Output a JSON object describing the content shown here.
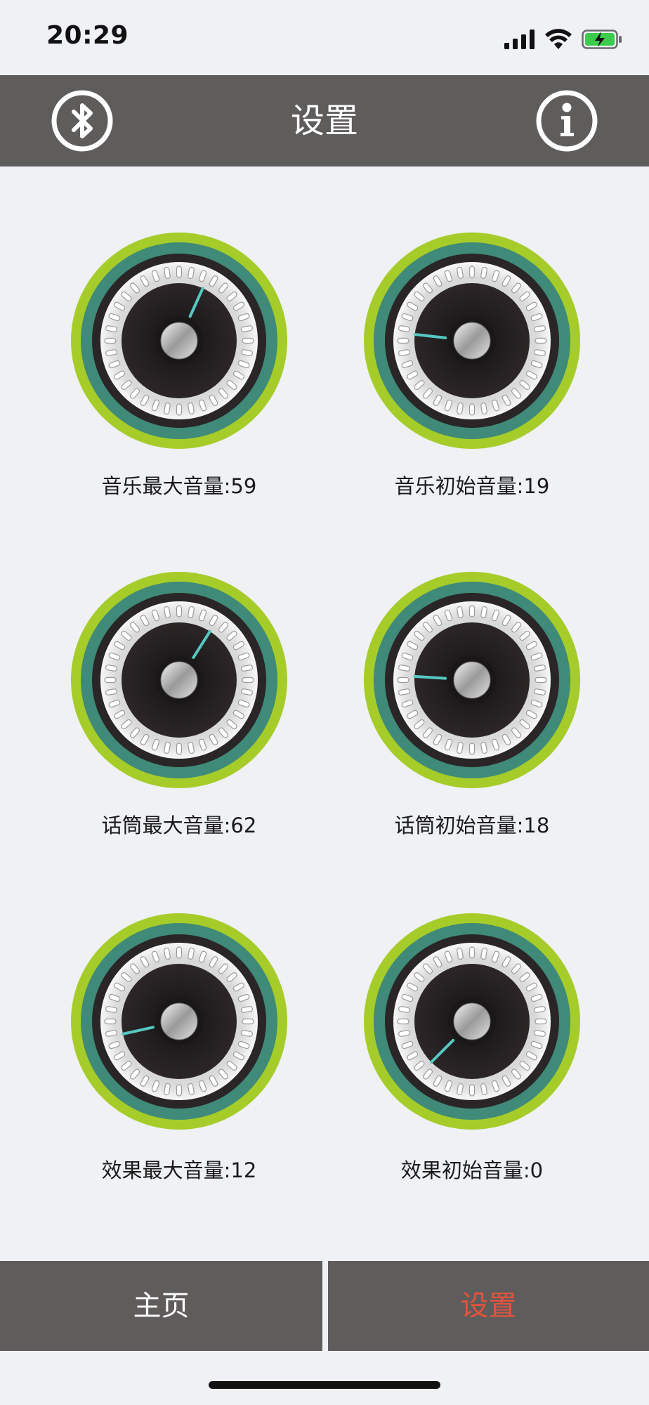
{
  "status_bar": {
    "time": "20:29",
    "icons": [
      "signal-icon",
      "wifi-icon",
      "battery-charging-icon"
    ]
  },
  "nav": {
    "title": "设置",
    "left_icon": "bluetooth-icon",
    "right_icon": "info-icon"
  },
  "colors": {
    "nav_bg": "#5f5c5c",
    "active_tab": "#e3533c",
    "ring_outer": "#a6cc2a",
    "ring_mid": "#3f8a78",
    "indicator": "#56c8c2"
  },
  "knobs": [
    {
      "label": "音乐最大音量:59",
      "value": 59
    },
    {
      "label": "音乐初始音量:19",
      "value": 19
    },
    {
      "label": "话筒最大音量:62",
      "value": 62
    },
    {
      "label": "话筒初始音量:18",
      "value": 18
    },
    {
      "label": "效果最大音量:12",
      "value": 12
    },
    {
      "label": "效果初始音量:0",
      "value": 0
    }
  ],
  "tabs": [
    {
      "label": "主页"
    },
    {
      "label": "设置"
    }
  ]
}
